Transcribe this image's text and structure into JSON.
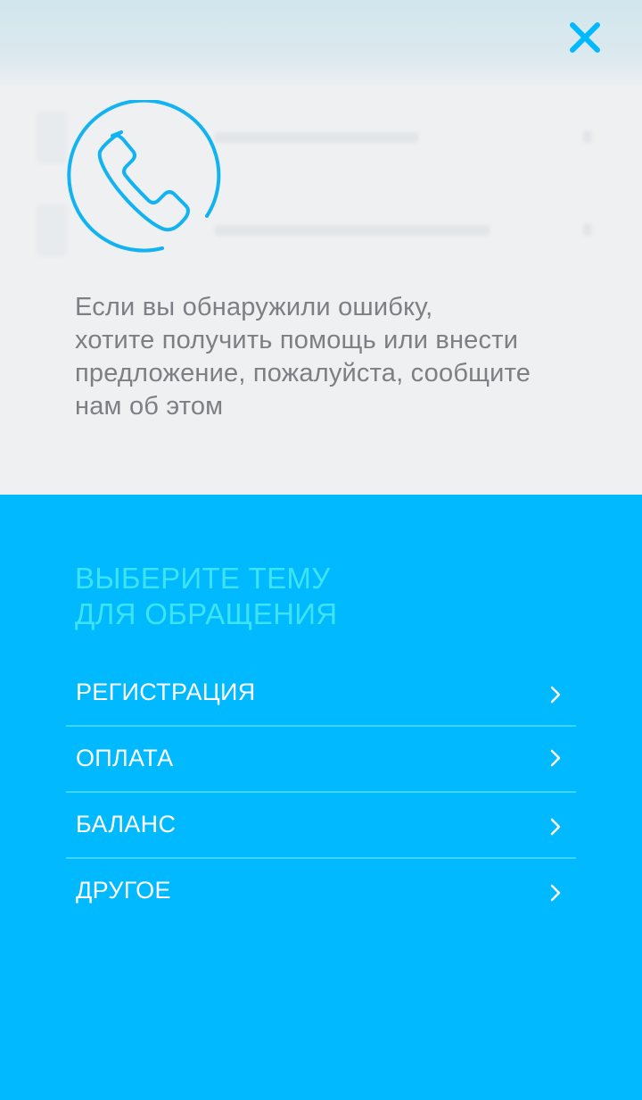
{
  "message": "Если вы обнаружили ошибку,\nхотите получить помощь или внести\nпредложение, пожалуйста, сообщите\nнам об этом",
  "section_title": "ВЫБЕРИТЕ ТЕМУ\nДЛЯ ОБРАЩЕНИЯ",
  "topics": [
    {
      "label": "РЕГИСТРАЦИЯ"
    },
    {
      "label": "ОПЛАТА"
    },
    {
      "label": "БАЛАНС"
    },
    {
      "label": "ДРУГОЕ"
    }
  ],
  "icons": {
    "close": "close-icon",
    "phone": "phone-icon",
    "chevron": "chevron-right-icon"
  },
  "colors": {
    "accent": "#00b9ff",
    "close": "#00b9ff",
    "icon_stroke": "#12b3f0",
    "section_title": "#3ce3f1",
    "message_text": "#7c7f83",
    "divider": "#3cd6ee"
  }
}
